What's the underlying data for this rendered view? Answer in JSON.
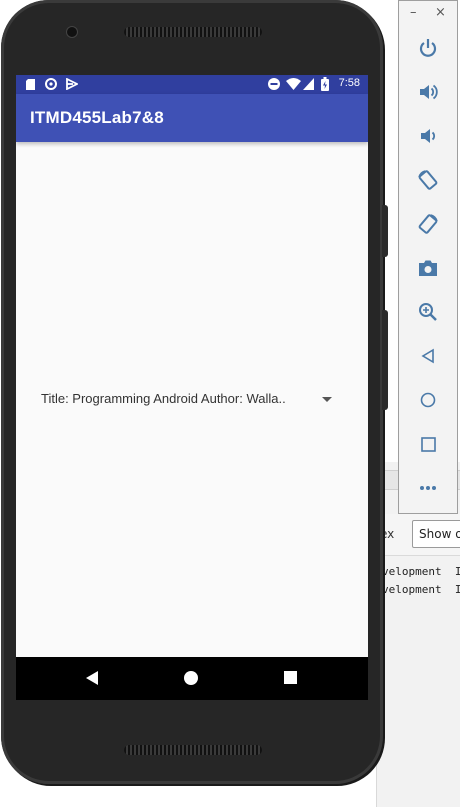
{
  "app": {
    "title": "ITMD455Lab7&8",
    "status_time": "7:58"
  },
  "spinner": {
    "selected_text": "Title: Programming Android Author: Walla.."
  },
  "ide": {
    "ex_label": "ex",
    "show_button": "Show or",
    "log_lines": [
      "velopment  I",
      "velopment  I"
    ]
  },
  "emulator": {
    "minimize": "–",
    "close": "×",
    "icons": [
      "power-icon",
      "volume-up-icon",
      "volume-down-icon",
      "rotate-left-icon",
      "rotate-right-icon",
      "camera-icon",
      "zoom-icon",
      "back-icon",
      "home-icon",
      "overview-icon",
      "more-icon"
    ]
  },
  "colors": {
    "primary": "#3f51b5",
    "primary_dark": "#303f9f",
    "background": "#fafafa",
    "emulator_icon": "#4a79a8"
  }
}
